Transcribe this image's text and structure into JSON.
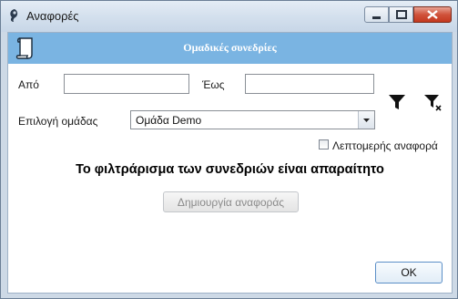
{
  "window": {
    "title": "Αναφορές",
    "controls": {
      "minimize": "minimize",
      "maximize": "maximize",
      "close": "close"
    }
  },
  "header": {
    "title": "Ομαδικές συνεδρίες",
    "icon": "document-scroll-icon"
  },
  "filters": {
    "from_label": "Από",
    "from_value": "",
    "to_label": "Έως",
    "to_value": "",
    "group_label": "Επιλογή ομάδας",
    "group_selected": "Ομάδα Demo",
    "apply_filter_icon": "filter-icon",
    "clear_filter_icon": "clear-filter-icon"
  },
  "detailed_report": {
    "label": "Λεπτομερής αναφορά",
    "checked": false
  },
  "message": "Το φιλτράρισμα των συνεδριών είναι απαραίτητο",
  "buttons": {
    "create_report": "Δημιουργία αναφοράς",
    "ok": "OK"
  },
  "colors": {
    "header_bg": "#7ab4e2",
    "window_frame": "#cdd9e6",
    "close_button": "#c4381f"
  }
}
